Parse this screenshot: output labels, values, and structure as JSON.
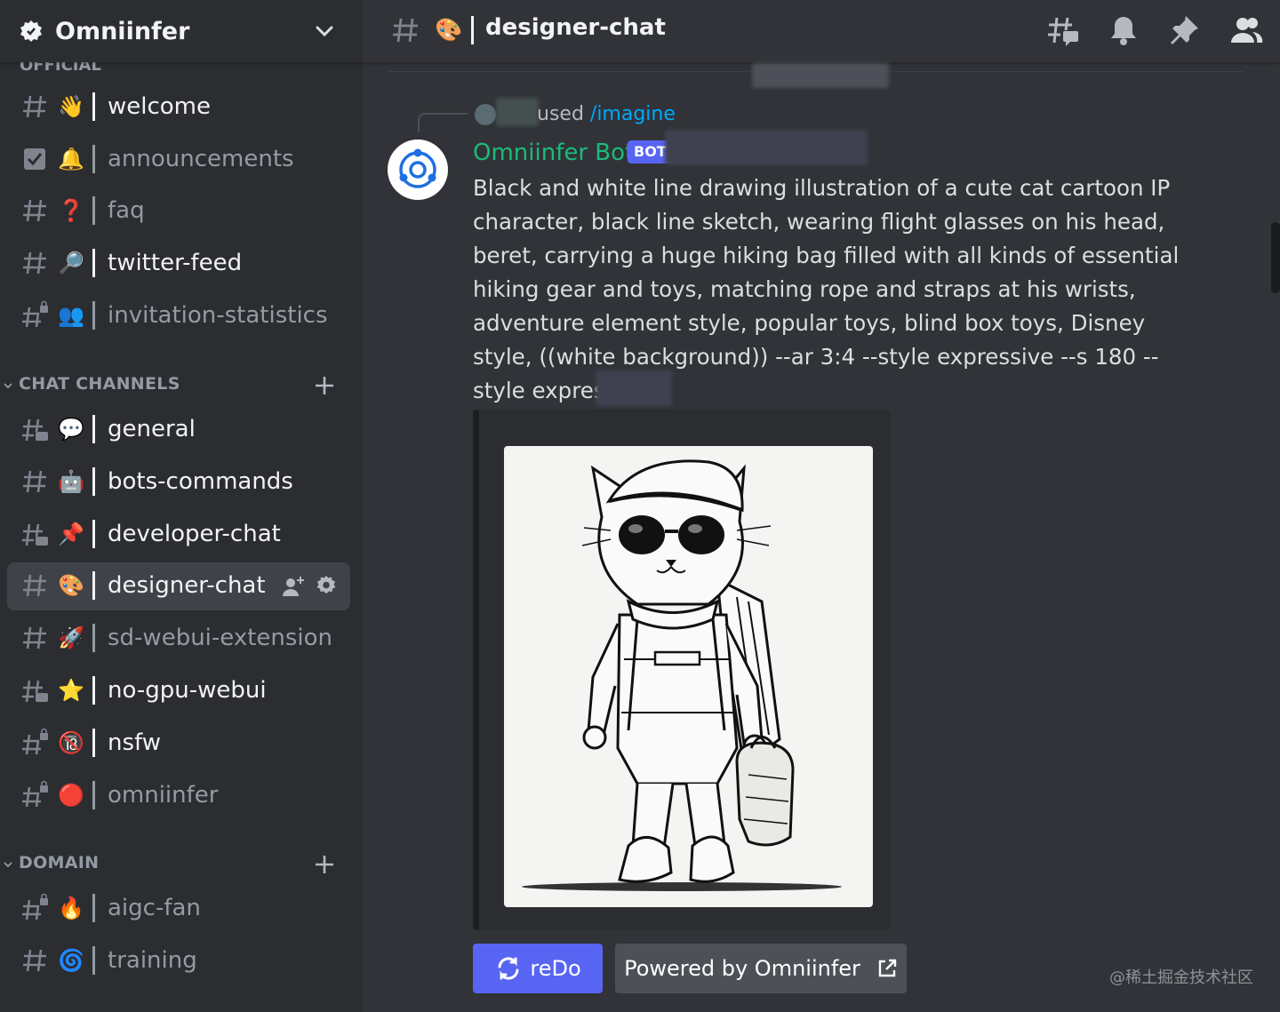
{
  "server": {
    "name": "Omniinfer",
    "cut_category": "OFFICIAL"
  },
  "channels_official": [
    {
      "name": "welcome",
      "emoji": "👋",
      "icon": "hash-icon",
      "muted": false
    },
    {
      "name": "announcements",
      "emoji": "🔔",
      "icon": "announcement-icon",
      "muted": true
    },
    {
      "name": "faq",
      "emoji": "❓",
      "icon": "hash-icon",
      "muted": true
    },
    {
      "name": "twitter-feed",
      "emoji": "🔎",
      "icon": "hash-icon",
      "muted": false
    },
    {
      "name": "invitation-statistics",
      "emoji": "👥",
      "icon": "hash-lock-icon",
      "muted": true
    }
  ],
  "category_chat": "CHAT CHANNELS",
  "channels_chat": [
    {
      "name": "general",
      "emoji": "💬",
      "icon": "hash-thread-icon",
      "muted": false
    },
    {
      "name": "bots-commands",
      "emoji": "🤖",
      "icon": "hash-icon",
      "muted": false
    },
    {
      "name": "developer-chat",
      "emoji": "📌",
      "icon": "hash-thread-icon",
      "muted": false
    },
    {
      "name": "designer-chat",
      "emoji": "🎨",
      "icon": "hash-icon",
      "muted": false,
      "selected": true
    },
    {
      "name": "sd-webui-extension",
      "emoji": "🚀",
      "icon": "hash-icon",
      "muted": true
    },
    {
      "name": "no-gpu-webui",
      "emoji": "⭐",
      "icon": "hash-thread-icon",
      "muted": false
    },
    {
      "name": "nsfw",
      "emoji": "🔞",
      "icon": "hash-lock-icon",
      "muted": false
    },
    {
      "name": "omniinfer",
      "emoji": "🔴",
      "icon": "hash-lock-icon",
      "muted": true
    }
  ],
  "category_domain": "DOMAIN",
  "channels_domain": [
    {
      "name": "aigc-fan",
      "emoji": "🔥",
      "icon": "hash-lock-icon",
      "muted": true
    },
    {
      "name": "training",
      "emoji": "🌀",
      "icon": "hash-icon",
      "muted": true
    }
  ],
  "topbar": {
    "channel_emoji": "🎨",
    "channel_name": "designer-chat"
  },
  "message": {
    "reply_used": "used ",
    "reply_command": "/imagine",
    "author": "Omniinfer Bot",
    "badge": "BOT",
    "text": "Black and white line drawing illustration of a cute cat cartoon IP character, black line sketch, wearing flight glasses on his head, beret, carrying a huge hiking bag filled with all kinds of essential hiking gear and toys, matching rope and straps at his wrists, adventure element style, popular toys, blind box toys, Disney style, ((white background)) --ar 3:4 --style expressive --s 180 --style expressive -",
    "redo_label": "reDo",
    "powered_label": "Powered by Omniinfer"
  },
  "watermark": "@稀土掘金技术社区",
  "colors": {
    "accent": "#5865f2",
    "bot_name": "#1abc7a",
    "command_link": "#00a8fc"
  }
}
